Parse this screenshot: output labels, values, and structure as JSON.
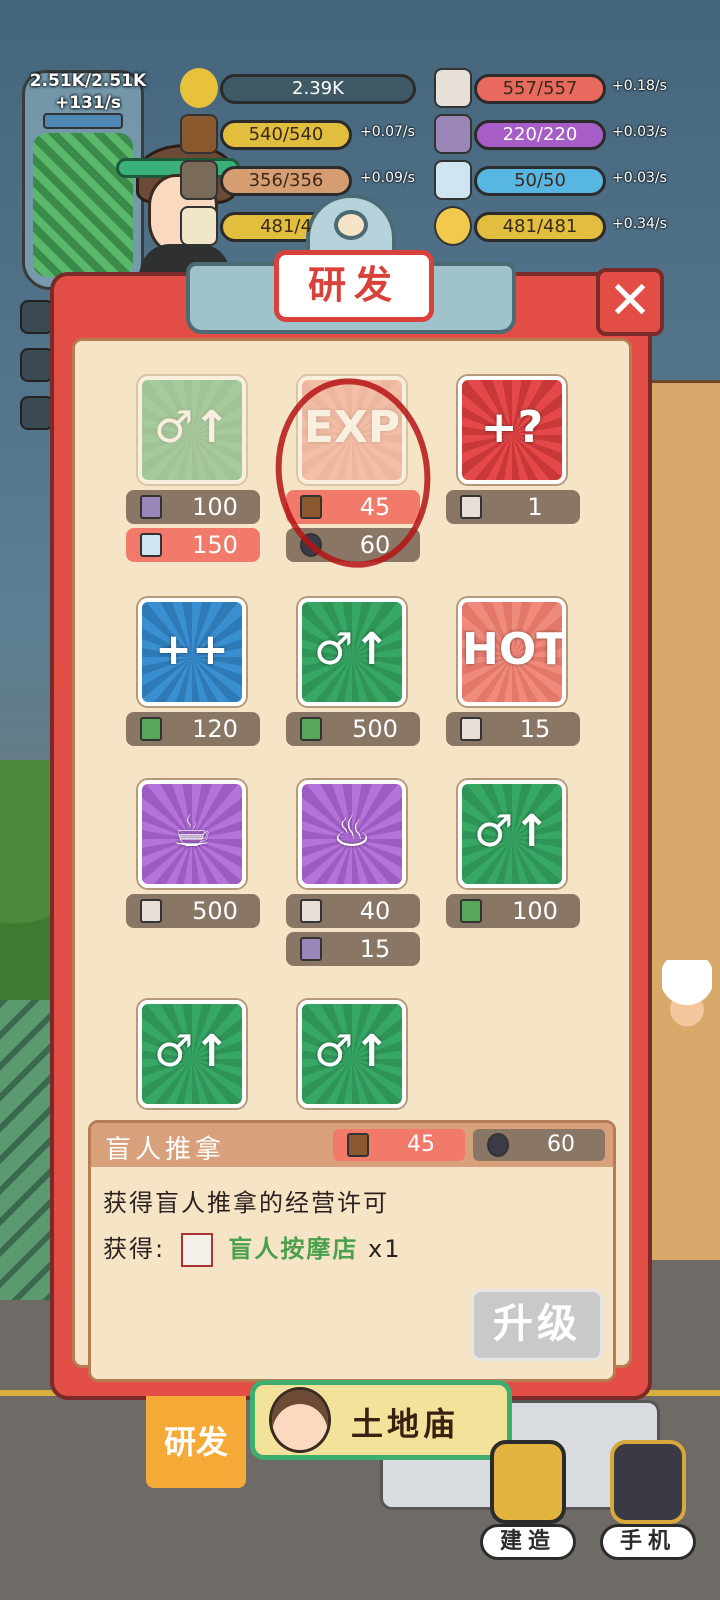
{
  "jar": {
    "capacity": "2.51K/2.51K",
    "rate": "+131/s"
  },
  "resources": [
    {
      "id": "stars",
      "icon": "star-icon",
      "value": "2.39K",
      "rate": "",
      "color": "#6e8c96"
    },
    {
      "id": "ticket",
      "icon": "ticket-icon",
      "value": "557/557",
      "rate": "+0.18/s",
      "color": "#e86a5e"
    },
    {
      "id": "wood",
      "icon": "wood-icon",
      "value": "540/540",
      "rate": "+0.07/s",
      "color": "#e2be3e"
    },
    {
      "id": "card",
      "icon": "card-icon",
      "value": "220/220",
      "rate": "+0.03/s",
      "color": "#a65ec6"
    },
    {
      "id": "ore",
      "icon": "ore-icon",
      "value": "356/356",
      "rate": "+0.09/s",
      "color": "#d79d72"
    },
    {
      "id": "bottle",
      "icon": "bottle-icon",
      "value": "50/50",
      "rate": "+0.03/s",
      "color": "#58b6e2"
    },
    {
      "id": "food",
      "icon": "food-icon",
      "value": "481/4",
      "rate": "/s",
      "color": "#e2be3e"
    },
    {
      "id": "moon",
      "icon": "moon-icon",
      "value": "481/481",
      "rate": "+0.34/s",
      "color": "#e2be3e"
    }
  ],
  "panel": {
    "title": "研发",
    "close_label": "✕"
  },
  "items": [
    {
      "id": "item-1",
      "icon": "mouth-upgrade-icon",
      "style": "green",
      "faded": true,
      "costs": [
        {
          "icon": "card",
          "value": "100",
          "warn": false
        },
        {
          "icon": "bottle",
          "value": "150",
          "warn": true
        }
      ]
    },
    {
      "id": "item-2",
      "icon": "exp-pot-icon",
      "style": "salmon",
      "faded": true,
      "label": "EXP",
      "costs": [
        {
          "icon": "wood",
          "value": "45",
          "warn": true
        },
        {
          "icon": "coal",
          "value": "60",
          "warn": false
        }
      ]
    },
    {
      "id": "item-3",
      "icon": "mystery-dice-icon",
      "style": "red",
      "faded": false,
      "glyph": "+?",
      "costs": [
        {
          "icon": "ticket",
          "value": "1",
          "warn": false
        }
      ]
    },
    {
      "id": "item-4",
      "icon": "house-expand-icon",
      "style": "blue",
      "faded": false,
      "glyph": "++",
      "costs": [
        {
          "icon": "cash",
          "value": "120",
          "warn": false
        }
      ]
    },
    {
      "id": "item-5",
      "icon": "mouth-upgrade-icon",
      "style": "green",
      "faded": false,
      "costs": [
        {
          "icon": "cash",
          "value": "500",
          "warn": false
        }
      ]
    },
    {
      "id": "item-6",
      "icon": "hot-shop-icon",
      "style": "salmon",
      "faded": false,
      "glyph": "HOT",
      "costs": [
        {
          "icon": "ticket",
          "value": "15",
          "warn": false
        }
      ]
    },
    {
      "id": "item-7",
      "icon": "tea-shop-icon",
      "style": "purple",
      "faded": false,
      "costs": [
        {
          "icon": "ticket",
          "value": "500",
          "warn": false
        }
      ]
    },
    {
      "id": "item-8",
      "icon": "chili-shop-icon",
      "style": "purple",
      "faded": false,
      "costs": [
        {
          "icon": "ticket",
          "value": "40",
          "warn": false
        },
        {
          "icon": "card",
          "value": "15",
          "warn": false
        }
      ]
    },
    {
      "id": "item-9",
      "icon": "mouth-upgrade-icon",
      "style": "green",
      "faded": false,
      "costs": [
        {
          "icon": "cash",
          "value": "100",
          "warn": false
        }
      ]
    },
    {
      "id": "item-10",
      "icon": "mouth-upgrade-icon",
      "style": "green",
      "faded": false,
      "costs": []
    },
    {
      "id": "item-11",
      "icon": "mouth-upgrade-icon",
      "style": "green",
      "faded": false,
      "costs": []
    }
  ],
  "detail": {
    "name": "盲人推拿",
    "cost_wood": "45",
    "cost_coal": "60",
    "description": "获得盲人推拿的经营许可",
    "gain_prefix": "获得:",
    "gain_name": "盲人按摩店",
    "gain_count": "x1",
    "upgrade_label": "升级"
  },
  "tabs": {
    "research": "研发",
    "temple": "土地庙"
  },
  "buttons": {
    "build": "建造",
    "phone": "手机"
  }
}
